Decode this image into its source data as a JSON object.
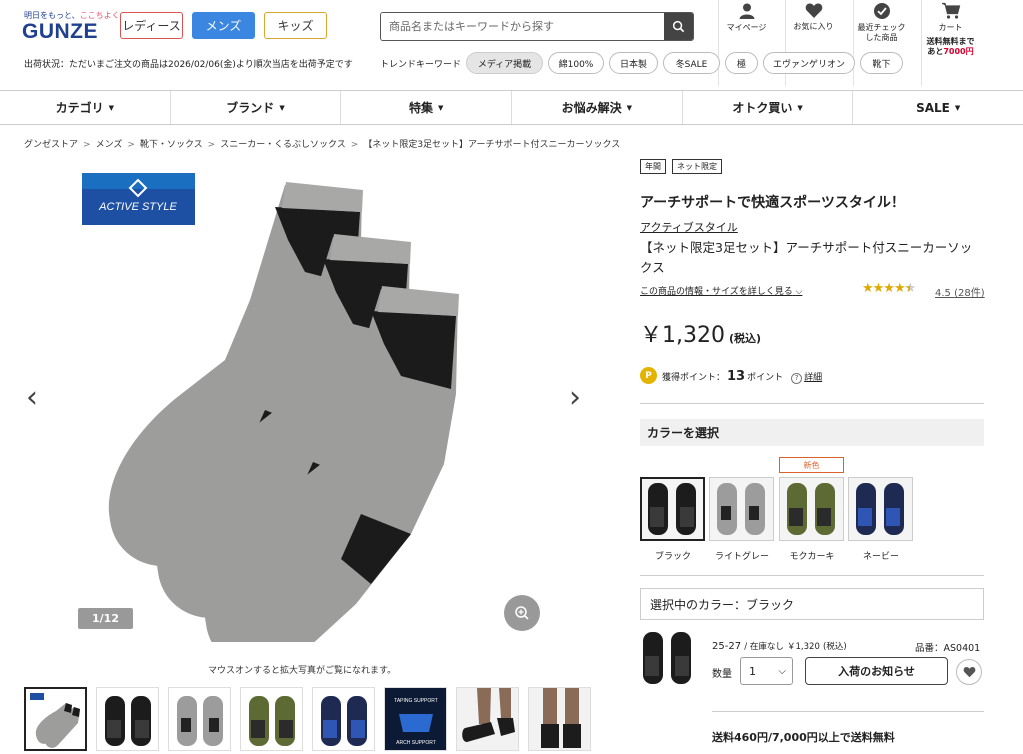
{
  "header": {
    "tagline_a": "明日をもっと、",
    "tagline_b": "ここちよく",
    "logo": "GUNZE",
    "gender_tabs": [
      "レディース",
      "メンズ",
      "キッズ"
    ],
    "search_placeholder": "商品名またはキーワードから探す",
    "icons": [
      {
        "icon": "user-icon",
        "label": "マイページ"
      },
      {
        "icon": "heart-icon",
        "label": "お気に入り"
      },
      {
        "icon": "check-icon",
        "label": "最近チェック\nした商品"
      },
      {
        "icon": "cart-icon",
        "label": "カート"
      }
    ],
    "cart_note_a": "送料無料まで",
    "cart_note_b": "あと",
    "cart_note_amount": "7000円",
    "shipping_status": "出荷状況：ただいまご注文の商品は2026/02/06(金)より順次当店を出荷予定です",
    "trend_title": "トレンドキーワード",
    "trend_keywords": [
      "メディア掲載",
      "綿100%",
      "日本製",
      "冬SALE",
      "極",
      "エヴァンゲリオン",
      "靴下"
    ]
  },
  "nav": [
    "カテゴリ",
    "ブランド",
    "特集",
    "お悩み解決",
    "オトク買い",
    "SALE"
  ],
  "breadcrumb": [
    "グンゼストア",
    "メンズ",
    "靴下・ソックス",
    "スニーカー・くるぶしソックス",
    "【ネット限定3足セット】アーチサポート付スニーカーソックス"
  ],
  "gallery": {
    "brand_badge": "ACTIVE STYLE",
    "counter": "1/12",
    "hover_note": "マウスオンすると拡大写真がご覧になれます。",
    "thumb_texts": [
      "TAPING SUPPORT",
      "ARCH SUPPORT"
    ]
  },
  "product": {
    "tags": [
      "年間",
      "ネット限定"
    ],
    "tagline": "アーチサポートで快適スポーツスタイル！",
    "brand": "アクティブスタイル",
    "name": "【ネット限定3足セット】アーチサポート付スニーカーソックス",
    "detail_link": "この商品の情報・サイズを詳しく見る",
    "rating": "4.5",
    "reviews": "(28件)",
    "stars": 4.5,
    "price": "￥1,320",
    "tax": "(税込)",
    "points_label": "獲得ポイント：",
    "points": "13",
    "points_unit": "ポイント",
    "points_detail": "詳細"
  },
  "colors": {
    "heading": "カラーを選択",
    "new_badge": "新色",
    "options": [
      {
        "label": "ブラック",
        "color": "#1c1c1c"
      },
      {
        "label": "ライトグレー",
        "color": "#9c9c9c"
      },
      {
        "label": "モクカーキ",
        "color": "#5e6a34"
      },
      {
        "label": "ネービー",
        "color": "#1e2a52"
      }
    ],
    "selected_text": "選択中のカラー：ブラック"
  },
  "variant": {
    "size": "25-27",
    "stock": "/ 在庫なし",
    "price": "￥1,320",
    "tax": "(税込)",
    "sku": "品番：AS0401",
    "qty_label": "数量",
    "qty_value": "1",
    "notify_label": "入荷のお知らせ"
  },
  "free_shipping": "送料460円/7,000円以上で送料無料"
}
